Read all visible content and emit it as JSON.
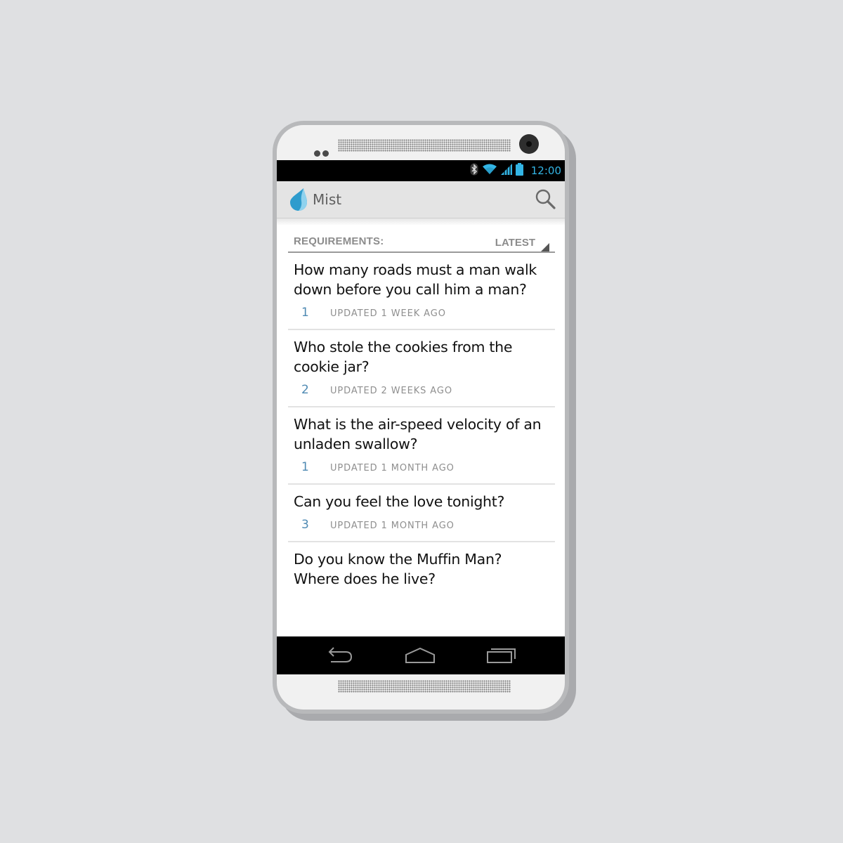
{
  "status_bar": {
    "time": "12:00",
    "icons": [
      "bluetooth-icon",
      "wifi-icon",
      "signal-icon",
      "battery-icon"
    ],
    "icon_color": "#33b5e5"
  },
  "action_bar": {
    "app_name": "Mist",
    "logo_icon": "water-drop-icon",
    "search_icon": "search-icon"
  },
  "list": {
    "header_label": "REQUIREMENTS:",
    "sort_label": "LATEST",
    "items": [
      {
        "title": "How many roads must a man walk down before you call him a man?",
        "count": "1",
        "updated": "UPDATED 1 WEEK AGO"
      },
      {
        "title": "Who stole the cookies from the cookie jar?",
        "count": "2",
        "updated": "UPDATED 2 WEEKS AGO"
      },
      {
        "title": "What is the air-speed velocity of an unladen swallow?",
        "count": "1",
        "updated": "UPDATED 1 MONTH AGO"
      },
      {
        "title": "Can you feel the love tonight?",
        "count": "3",
        "updated": "UPDATED 1 MONTH AGO"
      },
      {
        "title": "Do you know the Muffin Man? Where does he live?"
      }
    ]
  },
  "nav_bar": {
    "buttons": [
      "back-icon",
      "home-icon",
      "recent-apps-icon"
    ]
  },
  "colors": {
    "accent": "#33b5e5",
    "count_color": "#4f8ab3",
    "background": "#dfe0e2"
  }
}
